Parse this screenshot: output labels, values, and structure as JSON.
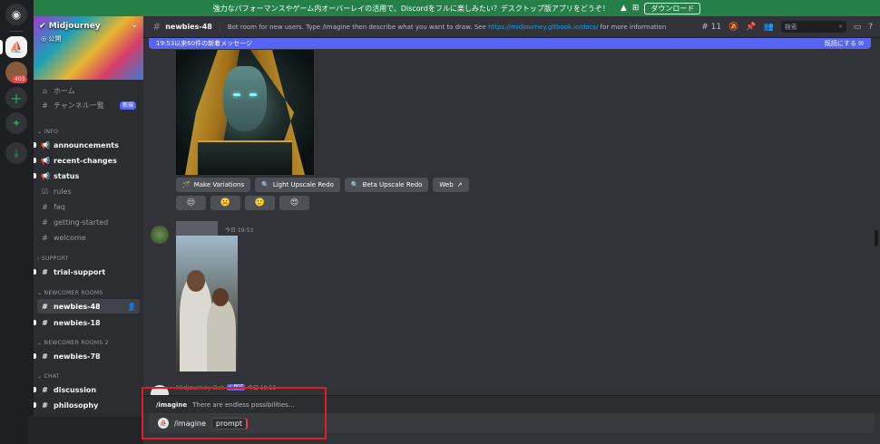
{
  "banner": {
    "text": "強力なパフォーマンスやゲーム内オーバーレイの活用で、Discordをフルに楽しみたい？デスクトップ版アプリをどうぞ！",
    "download_label": "ダウンロード",
    "os_icons": [
      "apple-icon",
      "android-icon",
      "windows-icon"
    ],
    "color": "#248046"
  },
  "rail": {
    "badge": "403"
  },
  "server": {
    "name": "Midjourney",
    "public_label": "公開"
  },
  "sidebar": {
    "home": "ホーム",
    "channel_list": "チャンネル一覧",
    "new_tag": "新規",
    "categories": {
      "info": "INFO",
      "support": "SUPPORT",
      "newcomer": "NEWCOMER ROOMS",
      "newcomer2": "NEWCOMER ROOMS 2",
      "chat": "CHAT"
    },
    "channels": {
      "announcements": "announcements",
      "recent_changes": "recent-changes",
      "status": "status",
      "rules": "rules",
      "faq": "faq",
      "getting_started": "getting-started",
      "welcome": "welcome",
      "trial_support": "trial-support",
      "newbies_48": "newbies-48",
      "newbies_18": "newbies-18",
      "newbies_78": "newbies-78",
      "discussion": "discussion",
      "philosophy": "philosophy"
    }
  },
  "header": {
    "channel": "newbies-48",
    "topic_prefix": "Bot room for new users. Type /imagine then describe what you want to draw. See ",
    "topic_link": "https://midjourney.gitbook.io/docs/",
    "topic_suffix": " for more information",
    "thread_count": "11",
    "search_placeholder": "検索"
  },
  "new_messages_bar": {
    "left": "19:53以来60件の新着メッセージ",
    "right": "既読にする"
  },
  "message1": {
    "buttons": [
      "Make Variations",
      "Light Upscale Redo",
      "Beta Upscale Redo",
      "Web"
    ],
    "reactions": [
      "😒",
      "☹️",
      "🙂",
      "😍"
    ]
  },
  "message2": {
    "timestamp": "今日 19:53"
  },
  "message3": {
    "author": "Midjourney Bot",
    "bot_badge": "✓ BOT",
    "timestamp": "今日 19:53"
  },
  "command_popup": {
    "command": "/imagine",
    "description": "There are endless possibilities..."
  },
  "input": {
    "command": "/imagine",
    "param": "prompt"
  },
  "colors": {
    "accent": "#5865f2",
    "highlight_frame": "#e31d1d"
  }
}
